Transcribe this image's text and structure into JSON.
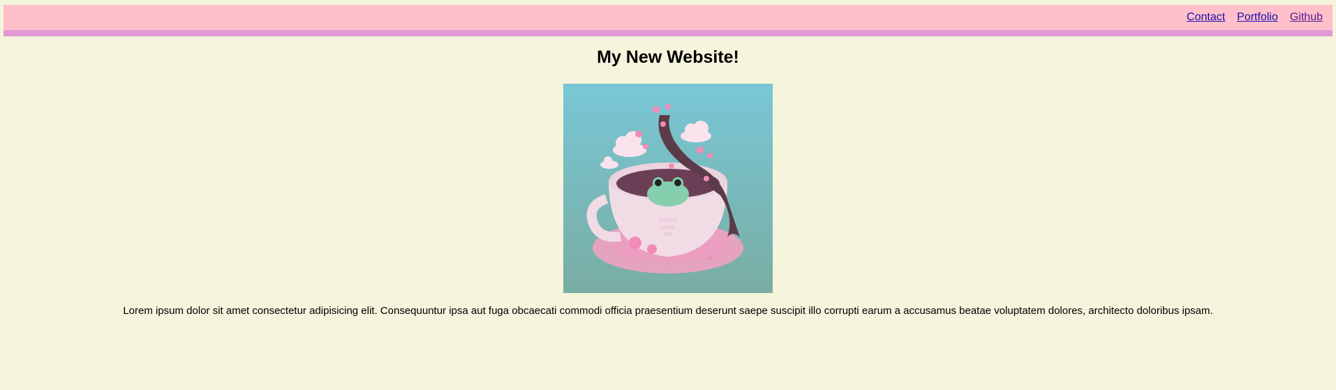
{
  "nav": {
    "links": [
      {
        "label": "Contact"
      },
      {
        "label": "Portfolio"
      },
      {
        "label": "Github"
      }
    ]
  },
  "main": {
    "title": "My New Website!",
    "paragraph": "Lorem ipsum dolor sit amet consectetur adipisicing elit. Consequuntur ipsa aut fuga obcaecati commodi officia praesentium deserunt saepe suscipit illo corrupti earum a accusamus beatae voluptatem dolores, architecto doloribus ipsam."
  },
  "colors": {
    "page_bg": "#f5f4dc",
    "nav_bg": "#ffc0cb",
    "nav_stripe": "#e09ad6"
  }
}
